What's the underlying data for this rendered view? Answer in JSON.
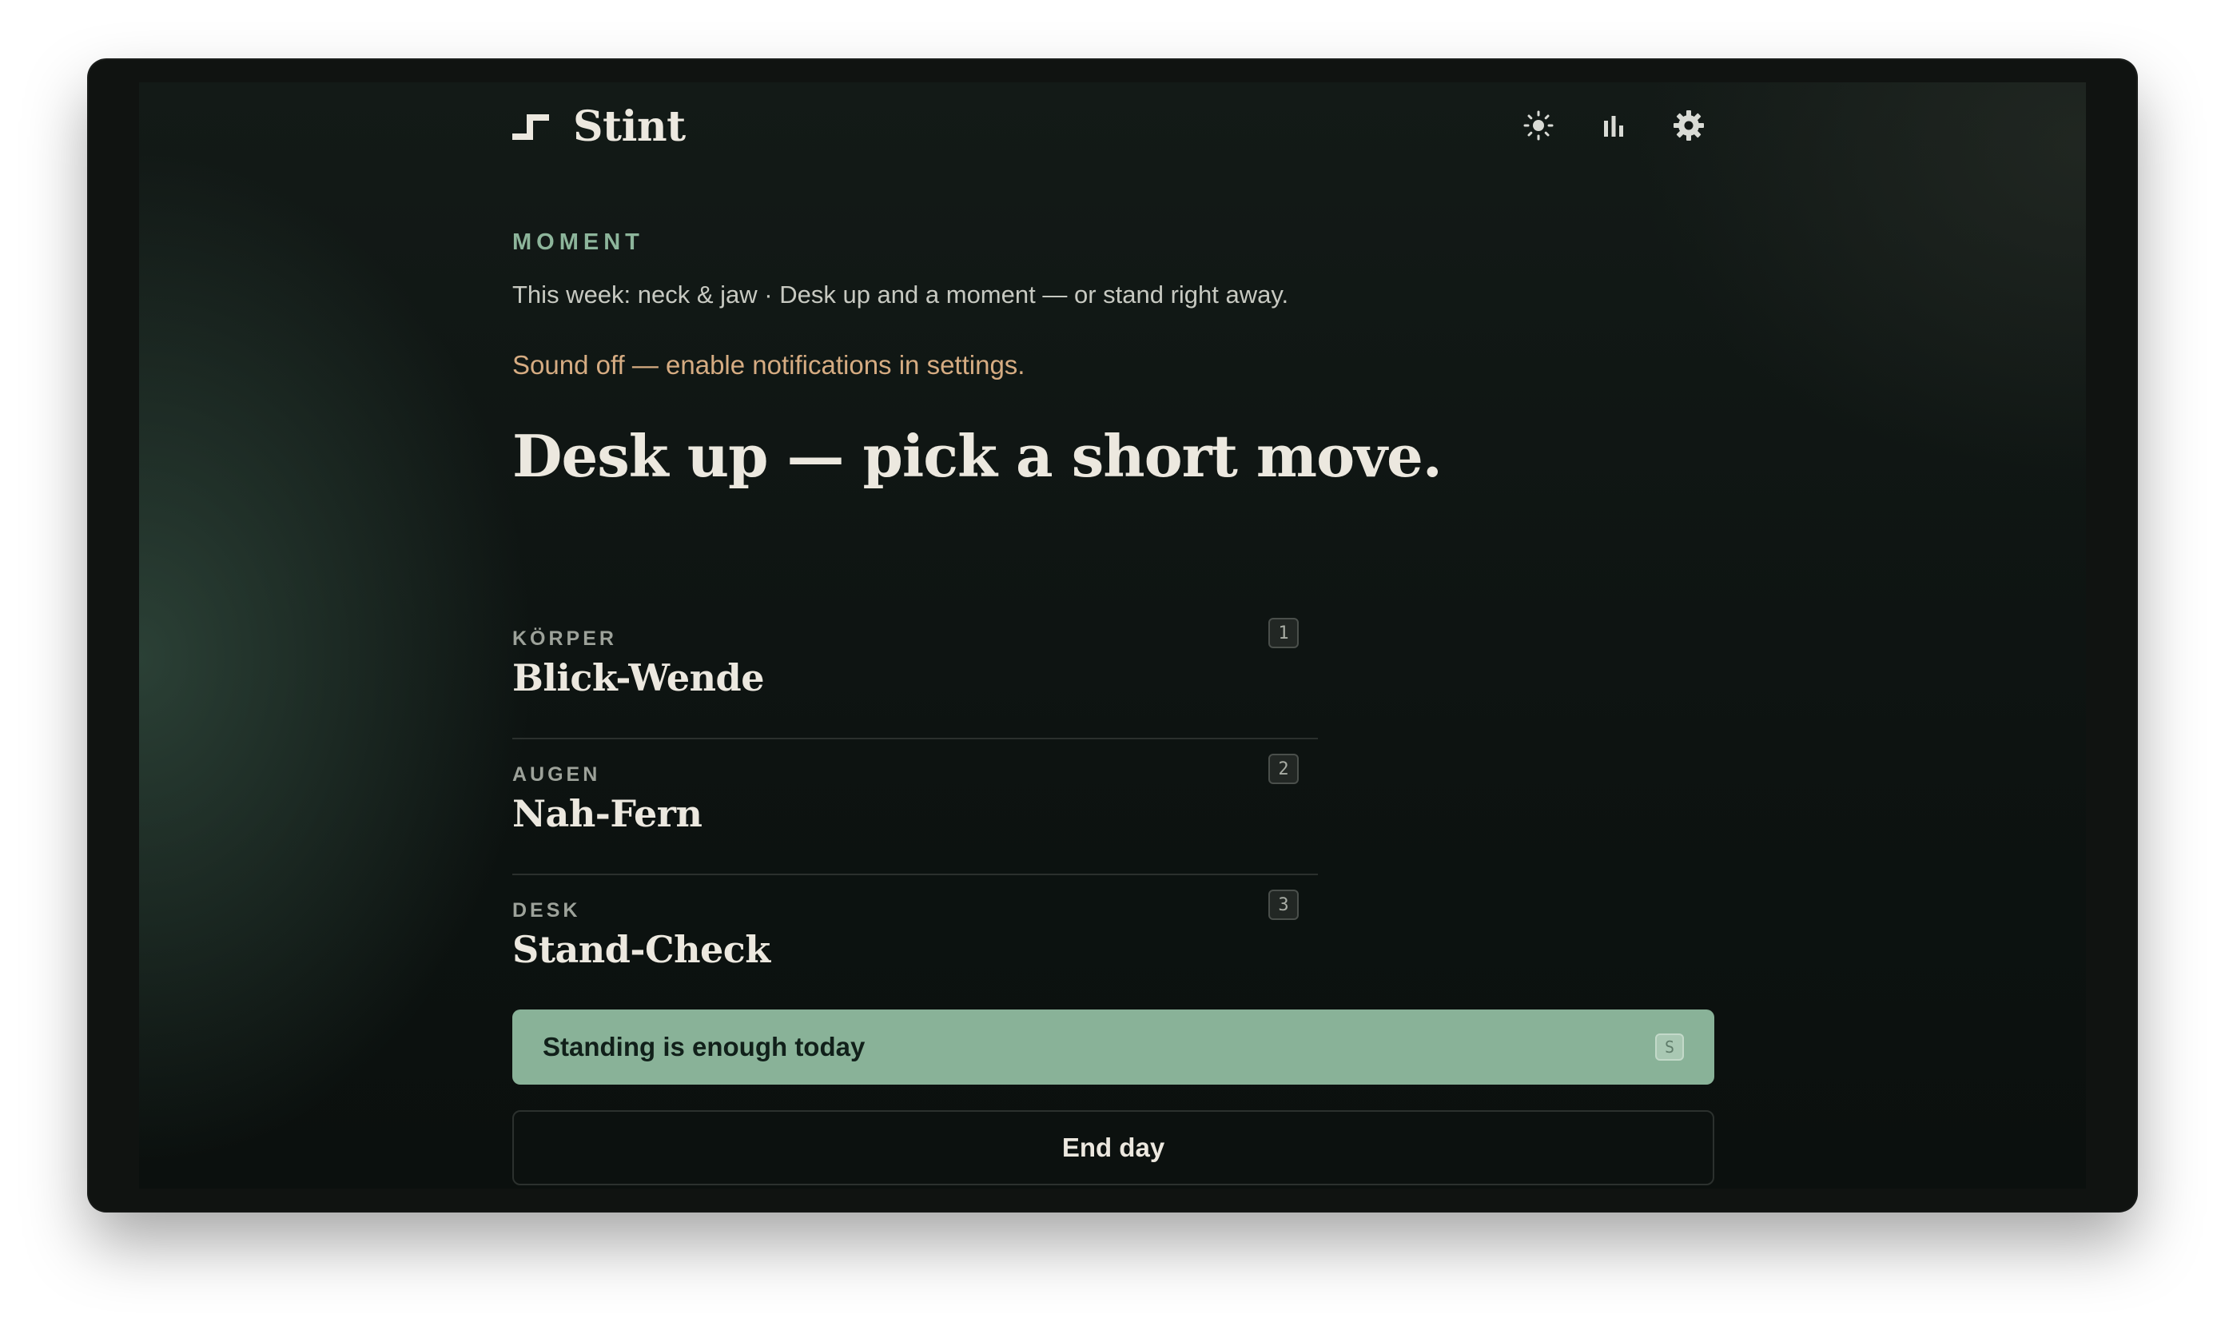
{
  "app": {
    "name": "Stint"
  },
  "toolbar": {
    "icons": [
      "sun-icon",
      "bar-chart-icon",
      "gear-icon"
    ]
  },
  "intro": {
    "eyebrow": "MOMENT",
    "week_line": "This week: neck & jaw · Desk up and a moment — or stand right away.",
    "notice": "Sound off — enable notifications in settings.",
    "headline": "Desk up — pick a short move."
  },
  "moves": [
    {
      "category": "KÖRPER",
      "title": "Blick-Wende",
      "key": "1"
    },
    {
      "category": "AUGEN",
      "title": "Nah-Fern",
      "key": "2"
    },
    {
      "category": "DESK",
      "title": "Stand-Check",
      "key": "3"
    }
  ],
  "actions": {
    "primary_label": "Standing is enough today",
    "primary_key": "S",
    "secondary_label": "End day"
  },
  "colors": {
    "accent": "#89b298",
    "eyebrow": "#8db59b",
    "notice": "#d6ac82",
    "text": "#ece8df",
    "background": "#101311"
  }
}
